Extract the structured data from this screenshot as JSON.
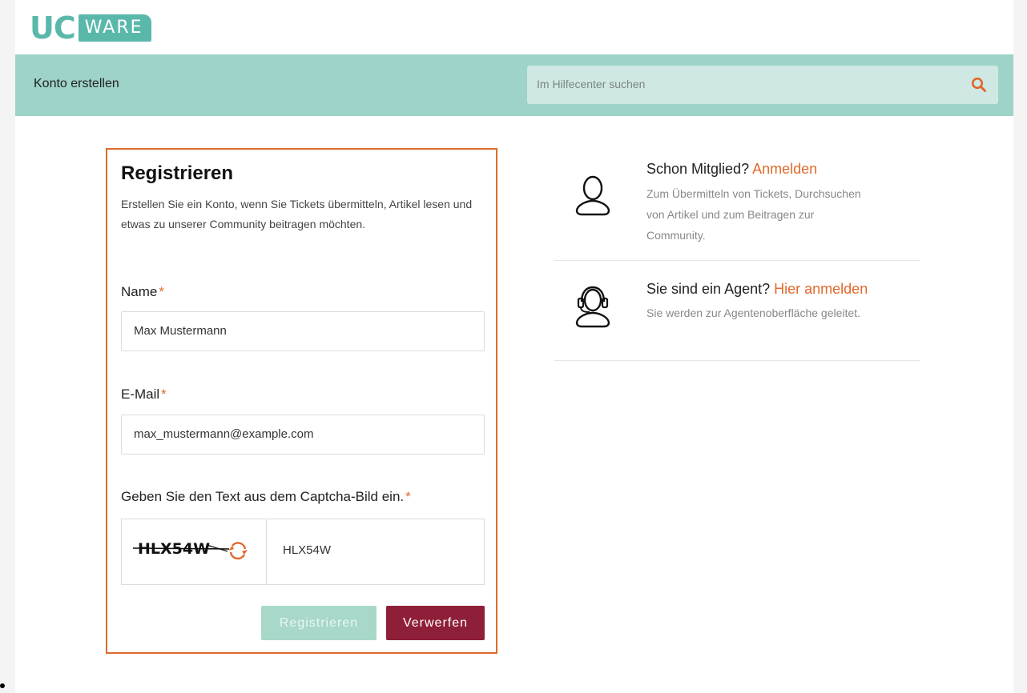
{
  "brand": {
    "logo_left": "UC",
    "logo_right": "WARE"
  },
  "header": {
    "title": "Konto erstellen",
    "search_placeholder": "Im Hilfecenter suchen"
  },
  "form": {
    "heading": "Registrieren",
    "intro": "Erstellen Sie ein Konto, wenn Sie Tickets übermitteln, Artikel lesen und etwas zu unserer Community beitragen möchten.",
    "required_mark": "*",
    "name_label": "Name",
    "name_value": "Max Mustermann",
    "email_label": "E-Mail",
    "email_value": "max_mustermann@example.com",
    "captcha_label": "Geben Sie den Text aus dem Captcha-Bild ein.",
    "captcha_image_text": "HLX54W",
    "captcha_value": "HLX54W",
    "register_button": "Registrieren",
    "discard_button": "Verwerfen"
  },
  "sidebar": {
    "member": {
      "title": "Schon Mitglied?",
      "link": "Anmelden",
      "desc": "Zum Übermitteln von Tickets, Durchsuchen von Artikel und zum Beitragen zur Community."
    },
    "agent": {
      "title": "Sie sind ein Agent?",
      "link": "Hier anmelden",
      "desc": "Sie werden zur Agentenoberfläche geleitet."
    }
  },
  "colors": {
    "accent": "#e06a2c",
    "brand_teal": "#5ab8ab",
    "header_bg": "#9dd3c8",
    "discard_bg": "#8e1f38",
    "register_bg_disabled": "#a7d8c9"
  }
}
